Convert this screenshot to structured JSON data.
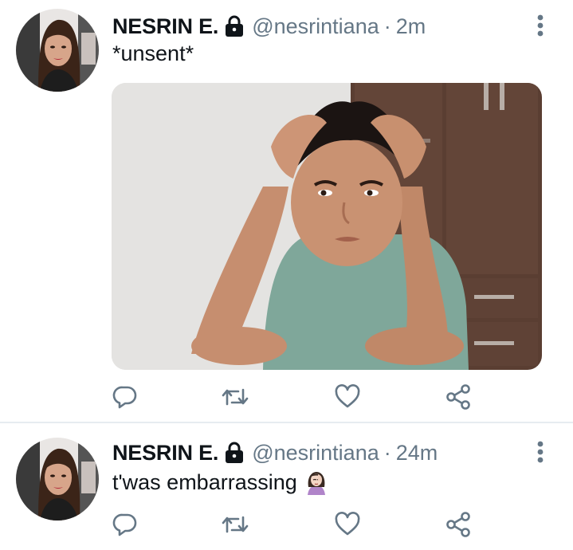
{
  "tweets": [
    {
      "author_name": "NESRIN E.",
      "handle": "@nesrintiana",
      "separator": "·",
      "time": "2m",
      "text": "*unsent*",
      "has_media": true,
      "protected": true
    },
    {
      "author_name": "NESRIN E.",
      "handle": "@nesrintiana",
      "separator": "·",
      "time": "24m",
      "text": "t'was embarrassing",
      "emoji": "woman-facepalming-emoji",
      "protected": true
    }
  ],
  "actions": [
    "reply-icon",
    "retweet-icon",
    "like-icon",
    "share-icon"
  ],
  "colors": {
    "text_primary": "#0f1419",
    "text_secondary": "#657786",
    "icon": "#657786",
    "divider": "#e6ecf0"
  }
}
